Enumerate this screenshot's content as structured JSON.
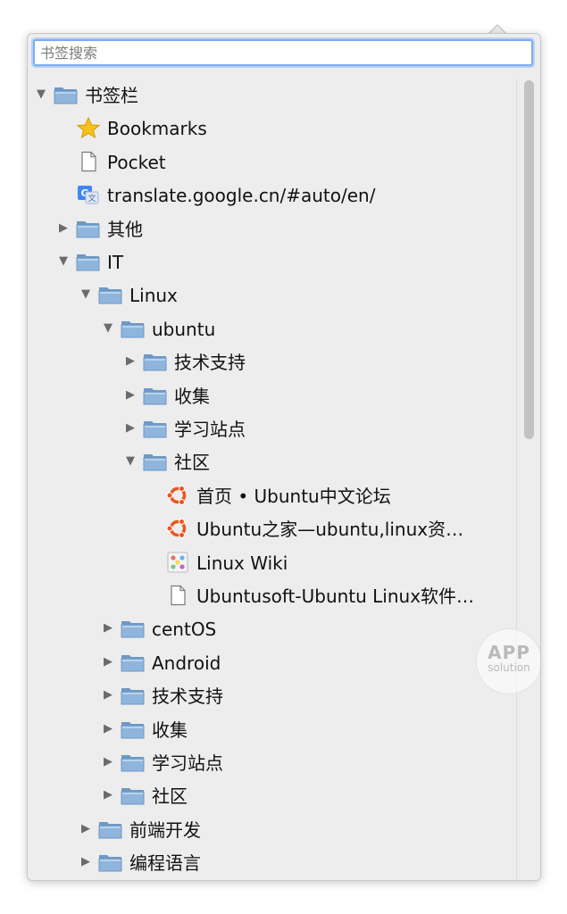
{
  "search": {
    "placeholder": "书签搜索",
    "value": ""
  },
  "tree": [
    {
      "label": "书签栏",
      "type": "folder",
      "level": 0,
      "state": "expanded",
      "name": "tree-item-bookmarks-toolbar"
    },
    {
      "label": "Bookmarks",
      "type": "star",
      "level": 1,
      "state": "none",
      "name": "tree-item-bookmarks"
    },
    {
      "label": "Pocket",
      "type": "page",
      "level": 1,
      "state": "none",
      "name": "tree-item-pocket"
    },
    {
      "label": "translate.google.cn/#auto/en/",
      "type": "google",
      "level": 1,
      "state": "none",
      "name": "tree-item-google-translate"
    },
    {
      "label": "其他",
      "type": "folder",
      "level": 1,
      "state": "collapsed",
      "name": "tree-item-other"
    },
    {
      "label": "IT",
      "type": "folder",
      "level": 1,
      "state": "expanded",
      "name": "tree-item-it"
    },
    {
      "label": "Linux",
      "type": "folder",
      "level": 2,
      "state": "expanded",
      "name": "tree-item-linux"
    },
    {
      "label": "ubuntu",
      "type": "folder",
      "level": 3,
      "state": "expanded",
      "name": "tree-item-ubuntu"
    },
    {
      "label": "技术支持",
      "type": "folder",
      "level": 4,
      "state": "collapsed",
      "name": "tree-item-ubuntu-tech-support"
    },
    {
      "label": "收集",
      "type": "folder",
      "level": 4,
      "state": "collapsed",
      "name": "tree-item-ubuntu-collection"
    },
    {
      "label": "学习站点",
      "type": "folder",
      "level": 4,
      "state": "collapsed",
      "name": "tree-item-ubuntu-learning-sites"
    },
    {
      "label": "社区",
      "type": "folder",
      "level": 4,
      "state": "expanded",
      "name": "tree-item-ubuntu-community"
    },
    {
      "label": "首页 • Ubuntu中文论坛",
      "type": "ubuntu",
      "level": 5,
      "state": "none",
      "name": "tree-item-ubuntu-forum"
    },
    {
      "label": "Ubuntu之家—ubuntu,linux资…",
      "type": "ubuntu",
      "level": 5,
      "state": "none",
      "name": "tree-item-ubuntu-home"
    },
    {
      "label": "Linux Wiki",
      "type": "wiki",
      "level": 5,
      "state": "none",
      "name": "tree-item-linux-wiki"
    },
    {
      "label": "Ubuntusoft-Ubuntu Linux软件…",
      "type": "page",
      "level": 5,
      "state": "none",
      "name": "tree-item-ubuntusoft"
    },
    {
      "label": "centOS",
      "type": "folder",
      "level": 3,
      "state": "collapsed",
      "name": "tree-item-centos"
    },
    {
      "label": "Android",
      "type": "folder",
      "level": 3,
      "state": "collapsed",
      "name": "tree-item-android"
    },
    {
      "label": "技术支持",
      "type": "folder",
      "level": 3,
      "state": "collapsed",
      "name": "tree-item-linux-tech-support"
    },
    {
      "label": "收集",
      "type": "folder",
      "level": 3,
      "state": "collapsed",
      "name": "tree-item-linux-collection"
    },
    {
      "label": "学习站点",
      "type": "folder",
      "level": 3,
      "state": "collapsed",
      "name": "tree-item-linux-learning-sites"
    },
    {
      "label": "社区",
      "type": "folder",
      "level": 3,
      "state": "collapsed",
      "name": "tree-item-linux-community"
    },
    {
      "label": "前端开发",
      "type": "folder",
      "level": 2,
      "state": "collapsed",
      "name": "tree-item-frontend-dev"
    },
    {
      "label": "编程语言",
      "type": "folder",
      "level": 2,
      "state": "collapsed",
      "name": "tree-item-programming-languages"
    }
  ],
  "scrollbar": {
    "position_fraction": 0.0,
    "visible_fraction": 0.45
  },
  "watermark": {
    "line1": "APP",
    "line2": "solution"
  },
  "colors": {
    "folder": "#8fb5dc",
    "folder_dark": "#6e98c4",
    "focus_ring": "#7aaef3",
    "ubuntu": "#e95420"
  }
}
